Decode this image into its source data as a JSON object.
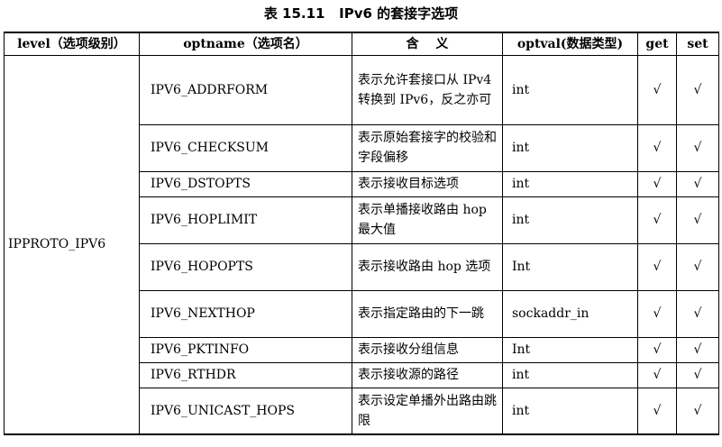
{
  "caption": "表 15.11   IPv6 的套接字选项",
  "headers": {
    "level": "level（选项级别）",
    "optname": "optname（选项名）",
    "meaning": "含　 义",
    "optval": "optval(数据类型)",
    "get": "get",
    "set": "set"
  },
  "level_value": "IPPROTO_IPV6",
  "rows": [
    {
      "optname": "IPV6_ADDRFORM",
      "desc": "表示允许套接口从 IPv4 转换到 IPv6，反之亦可",
      "optval": "int",
      "get": "√",
      "set": "√"
    },
    {
      "optname": "IPV6_CHECKSUM",
      "desc": "表示原始套接字的校验和字段偏移",
      "optval": "int",
      "get": "√",
      "set": "√"
    },
    {
      "optname": "IPV6_DSTOPTS",
      "desc": "表示接收目标选项",
      "optval": "int",
      "get": "√",
      "set": "√"
    },
    {
      "optname": "IPV6_HOPLIMIT",
      "desc": "表示单播接收路由 hop 最大值",
      "optval": "int",
      "get": "√",
      "set": "√"
    },
    {
      "optname": "IPV6_HOPOPTS",
      "desc": "表示接收路由 hop 选项",
      "optval": "Int",
      "get": "√",
      "set": "√"
    },
    {
      "optname": "IPV6_NEXTHOP",
      "desc": "表示指定路由的下一跳",
      "optval": "sockaddr_in",
      "get": "√",
      "set": "√"
    },
    {
      "optname": "IPV6_PKTINFO",
      "desc": "表示接收分组信息",
      "optval": "Int",
      "get": "√",
      "set": "√"
    },
    {
      "optname": "IPV6_RTHDR",
      "desc": "表示接收源的路径",
      "optval": "int",
      "get": "√",
      "set": "√"
    },
    {
      "optname": "IPV6_UNICAST_HOPS",
      "desc": "表示设定单播外出路由跳限",
      "optval": "int",
      "get": "√",
      "set": "√"
    }
  ]
}
